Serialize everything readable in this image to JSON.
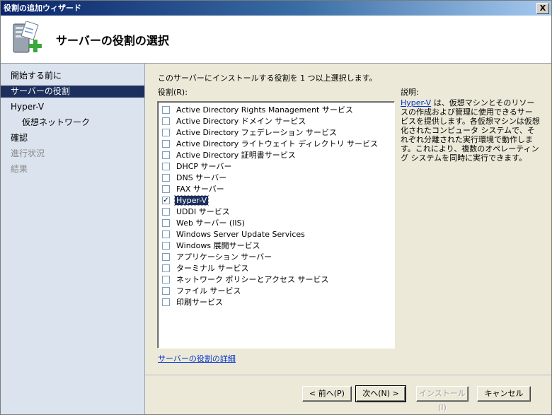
{
  "window": {
    "title": "役割の追加ウィザード",
    "close_label": "X"
  },
  "header": {
    "title": "サーバーの役割の選択",
    "icon": "server-add-icon"
  },
  "nav": {
    "items": [
      {
        "label": "開始する前に",
        "state": "normal",
        "indent": false
      },
      {
        "label": "サーバーの役割",
        "state": "selected",
        "indent": false
      },
      {
        "label": "Hyper-V",
        "state": "normal",
        "indent": false
      },
      {
        "label": "仮想ネットワーク",
        "state": "normal",
        "indent": true
      },
      {
        "label": "確認",
        "state": "normal",
        "indent": false
      },
      {
        "label": "進行状況",
        "state": "disabled",
        "indent": false
      },
      {
        "label": "結果",
        "state": "disabled",
        "indent": false
      }
    ]
  },
  "main": {
    "instruction": "このサーバーにインストールする役割を 1 つ以上選択します。",
    "roles_label": "役割(R):",
    "roles": [
      {
        "label": "Active Directory Rights Management サービス",
        "checked": false,
        "selected": false
      },
      {
        "label": "Active Directory ドメイン サービス",
        "checked": false,
        "selected": false
      },
      {
        "label": "Active Directory フェデレーション サービス",
        "checked": false,
        "selected": false
      },
      {
        "label": "Active Directory ライトウェイト ディレクトリ サービス",
        "checked": false,
        "selected": false
      },
      {
        "label": "Active Directory 証明書サービス",
        "checked": false,
        "selected": false
      },
      {
        "label": "DHCP サーバー",
        "checked": false,
        "selected": false
      },
      {
        "label": "DNS サーバー",
        "checked": false,
        "selected": false
      },
      {
        "label": "FAX サーバー",
        "checked": false,
        "selected": false
      },
      {
        "label": "Hyper-V",
        "checked": true,
        "selected": true
      },
      {
        "label": "UDDI サービス",
        "checked": false,
        "selected": false
      },
      {
        "label": "Web サーバー (IIS)",
        "checked": false,
        "selected": false
      },
      {
        "label": "Windows Server Update Services",
        "checked": false,
        "selected": false
      },
      {
        "label": "Windows 展開サービス",
        "checked": false,
        "selected": false
      },
      {
        "label": "アプリケーション サーバー",
        "checked": false,
        "selected": false
      },
      {
        "label": "ターミナル サービス",
        "checked": false,
        "selected": false
      },
      {
        "label": "ネットワーク ポリシーとアクセス サービス",
        "checked": false,
        "selected": false
      },
      {
        "label": "ファイル サービス",
        "checked": false,
        "selected": false
      },
      {
        "label": "印刷サービス",
        "checked": false,
        "selected": false
      }
    ],
    "description_label": "説明:",
    "description_link": "Hyper-V",
    "description_text": " は、仮想マシンとそのリソースの作成および管理に使用できるサービスを提供します。各仮想マシンは仮想化されたコンピュータ システムで、それぞれ分離された実行環境で動作します。これにより、複数のオペレーティング システムを同時に実行できます。",
    "details_link": "サーバーの役割の詳細"
  },
  "buttons": {
    "back": "< 前へ(P)",
    "next": "次へ(N) >",
    "install": "インストール(I)",
    "cancel": "キャンセル"
  },
  "colors": {
    "selection": "#1d2f5c",
    "nav_bg": "#dbe3ee",
    "link": "#0033cc"
  }
}
